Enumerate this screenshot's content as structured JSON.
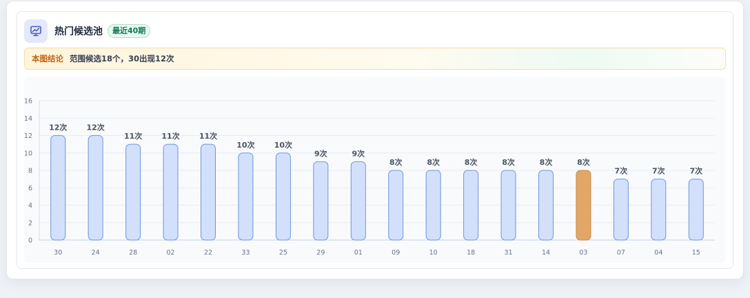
{
  "header": {
    "title": "热门候选池",
    "badge": "最近40期",
    "icon": "chart-trend-icon"
  },
  "conclusion": {
    "label": "本图结论",
    "text": "范围候选18个，30出现12次"
  },
  "colors": {
    "bar_fill": "#d2e0fb",
    "bar_stroke": "#6e96da",
    "highlight_fill": "#e2a766",
    "highlight_stroke": "#c98a4a",
    "value_label": "#4b5563",
    "tick_label": "#6b7280"
  },
  "chart_data": {
    "type": "bar",
    "categories": [
      "30",
      "24",
      "28",
      "02",
      "22",
      "33",
      "25",
      "29",
      "01",
      "09",
      "10",
      "18",
      "31",
      "14",
      "03",
      "07",
      "04",
      "15"
    ],
    "values": [
      12,
      12,
      11,
      11,
      11,
      10,
      10,
      9,
      9,
      8,
      8,
      8,
      8,
      8,
      8,
      7,
      7,
      7
    ],
    "data_labels": [
      "12次",
      "12次",
      "11次",
      "11次",
      "11次",
      "10次",
      "10次",
      "9次",
      "9次",
      "8次",
      "8次",
      "8次",
      "8次",
      "8次",
      "8次",
      "7次",
      "7次",
      "7次"
    ],
    "highlight": "03",
    "ylim": [
      0,
      16
    ],
    "yticks": [
      0,
      2,
      4,
      6,
      8,
      10,
      12,
      14,
      16
    ],
    "grid": true,
    "title": "",
    "xlabel": "",
    "ylabel": ""
  }
}
